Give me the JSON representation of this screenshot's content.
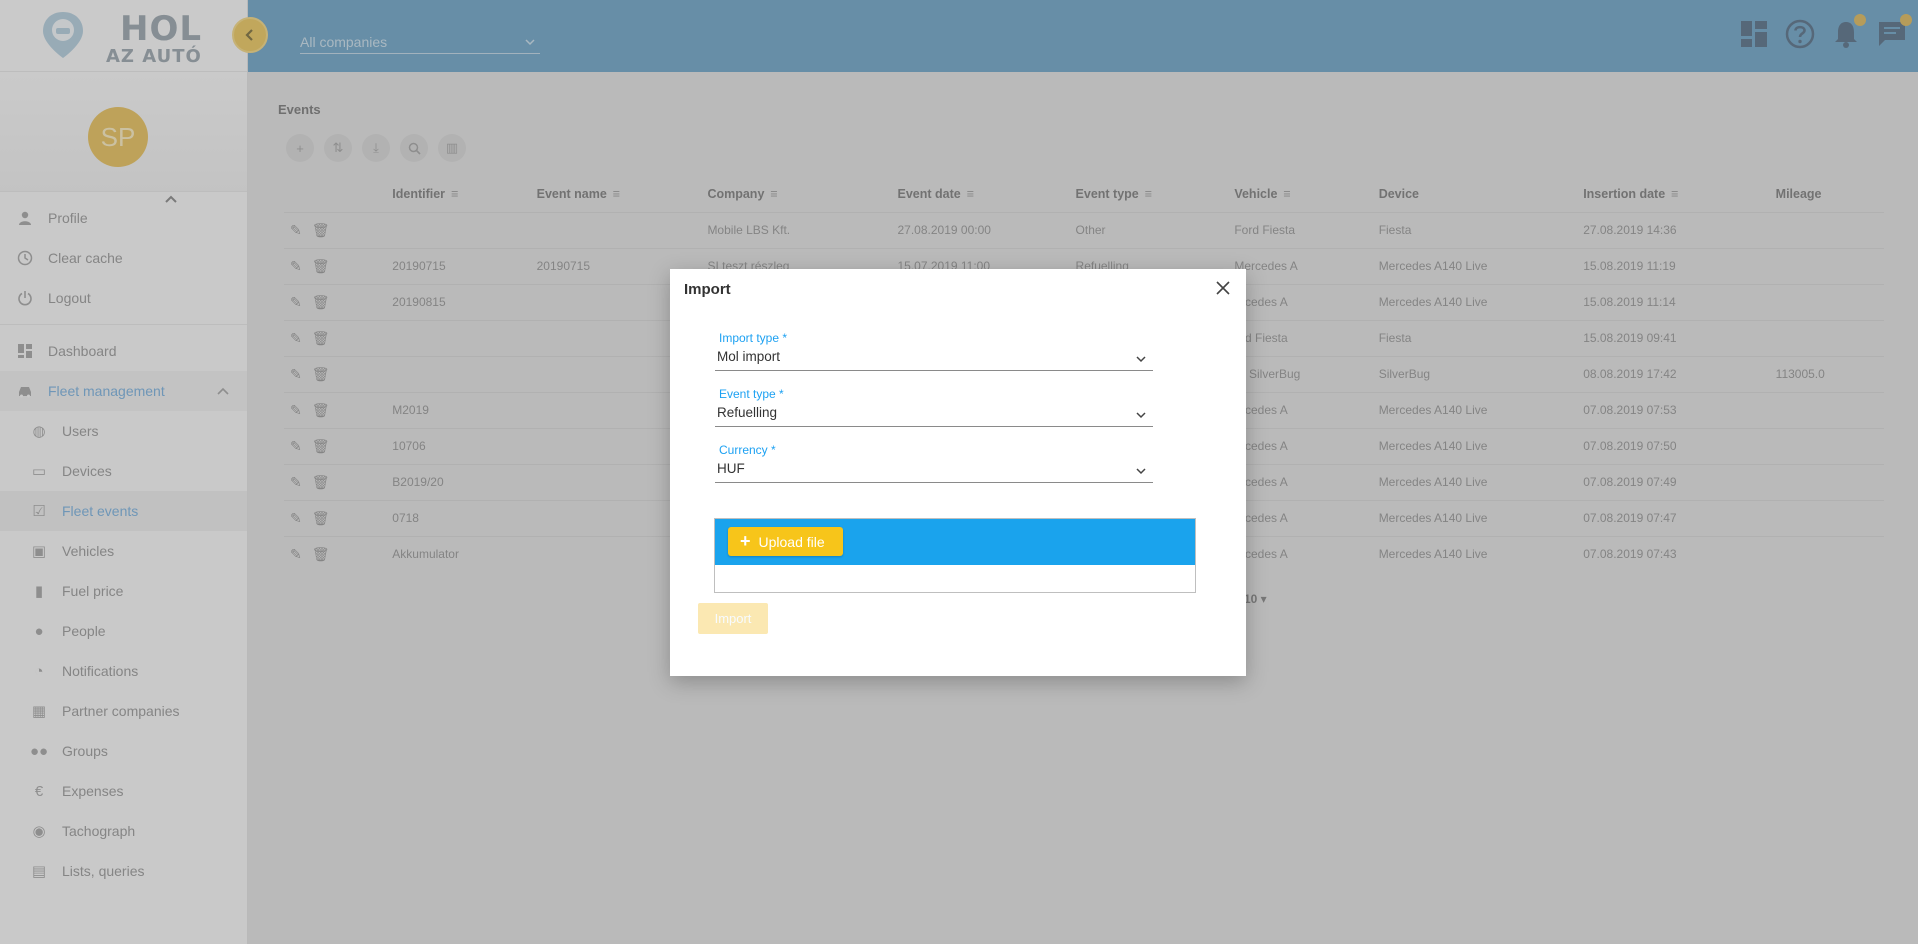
{
  "brand": {
    "line1": "HOL",
    "line2": "AZ AUTÓ"
  },
  "user": {
    "initials": "SP"
  },
  "header": {
    "company_select": "All companies"
  },
  "sidebar": {
    "account_items": [
      {
        "label": "Profile",
        "icon": "person-icon"
      },
      {
        "label": "Clear cache",
        "icon": "clock-icon"
      },
      {
        "label": "Logout",
        "icon": "power-icon"
      }
    ],
    "dashboard": "Dashboard",
    "fleet_group": "Fleet management",
    "sub_items": [
      {
        "label": "Users",
        "icon": "globe-icon"
      },
      {
        "label": "Devices",
        "icon": "devices-icon"
      },
      {
        "label": "Fleet events",
        "icon": "calendar-check-icon",
        "active": true
      },
      {
        "label": "Vehicles",
        "icon": "car-icon"
      },
      {
        "label": "Fuel price",
        "icon": "fuel-icon"
      },
      {
        "label": "People",
        "icon": "person-icon"
      },
      {
        "label": "Notifications",
        "icon": "alarm-icon"
      },
      {
        "label": "Partner companies",
        "icon": "building-icon"
      },
      {
        "label": "Groups",
        "icon": "group-icon"
      },
      {
        "label": "Expenses",
        "icon": "euro-icon"
      },
      {
        "label": "Tachograph",
        "icon": "gauge-icon"
      },
      {
        "label": "Lists, queries",
        "icon": "chart-icon"
      }
    ]
  },
  "main": {
    "title": "Events",
    "columns": [
      "Identifier",
      "Event name",
      "Company",
      "Event date",
      "Event type",
      "Vehicle",
      "Device",
      "Insertion date",
      "Mileage"
    ],
    "rows": [
      [
        "",
        "",
        "Mobile LBS Kft.",
        "27.08.2019 00:00",
        "Other",
        "Ford Fiesta",
        "Fiesta",
        "27.08.2019 14:36",
        ""
      ],
      [
        "20190715",
        "20190715",
        "SI teszt részleg",
        "15.07.2019 11:00",
        "Refuelling",
        "Mercedes A",
        "Mercedes A140 Live",
        "15.08.2019 11:19",
        ""
      ],
      [
        "20190815",
        "",
        "",
        "",
        "",
        "ercedes A",
        "Mercedes A140 Live",
        "15.08.2019 11:14",
        ""
      ],
      [
        "",
        "",
        "",
        "",
        "",
        "ord Fiesta",
        "Fiesta",
        "15.08.2019 09:41",
        ""
      ],
      [
        "",
        "",
        "",
        "",
        "",
        "W SilverBug",
        "SilverBug",
        "08.08.2019 17:42",
        "113005.0"
      ],
      [
        "M2019",
        "",
        "",
        "",
        "",
        "ercedes A",
        "Mercedes A140 Live",
        "07.08.2019 07:53",
        ""
      ],
      [
        "10706",
        "",
        "",
        "",
        "",
        "ercedes A",
        "Mercedes A140 Live",
        "07.08.2019 07:50",
        ""
      ],
      [
        "B2019/20",
        "",
        "",
        "",
        "",
        "ercedes A",
        "Mercedes A140 Live",
        "07.08.2019 07:49",
        ""
      ],
      [
        "0718",
        "",
        "",
        "",
        "",
        "ercedes A",
        "Mercedes A140 Live",
        "07.08.2019 07:47",
        ""
      ],
      [
        "Akkumulator",
        "",
        "",
        "",
        "",
        "ercedes A",
        "Mercedes A140 Live",
        "07.08.2019 07:43",
        ""
      ]
    ],
    "pager_fragment": "10 ▾"
  },
  "dialog": {
    "title": "Import",
    "import_type": {
      "label": "Import type *",
      "value": "Mol import"
    },
    "event_type": {
      "label": "Event type *",
      "value": "Refuelling"
    },
    "currency": {
      "label": "Currency *",
      "value": "HUF"
    },
    "upload_label": "Upload file",
    "import_label": "Import"
  },
  "colors": {
    "header": "#5f9ac0",
    "accent": "#1aa3ed",
    "upload_button": "#f7c51a",
    "label": "#1da1f2"
  }
}
